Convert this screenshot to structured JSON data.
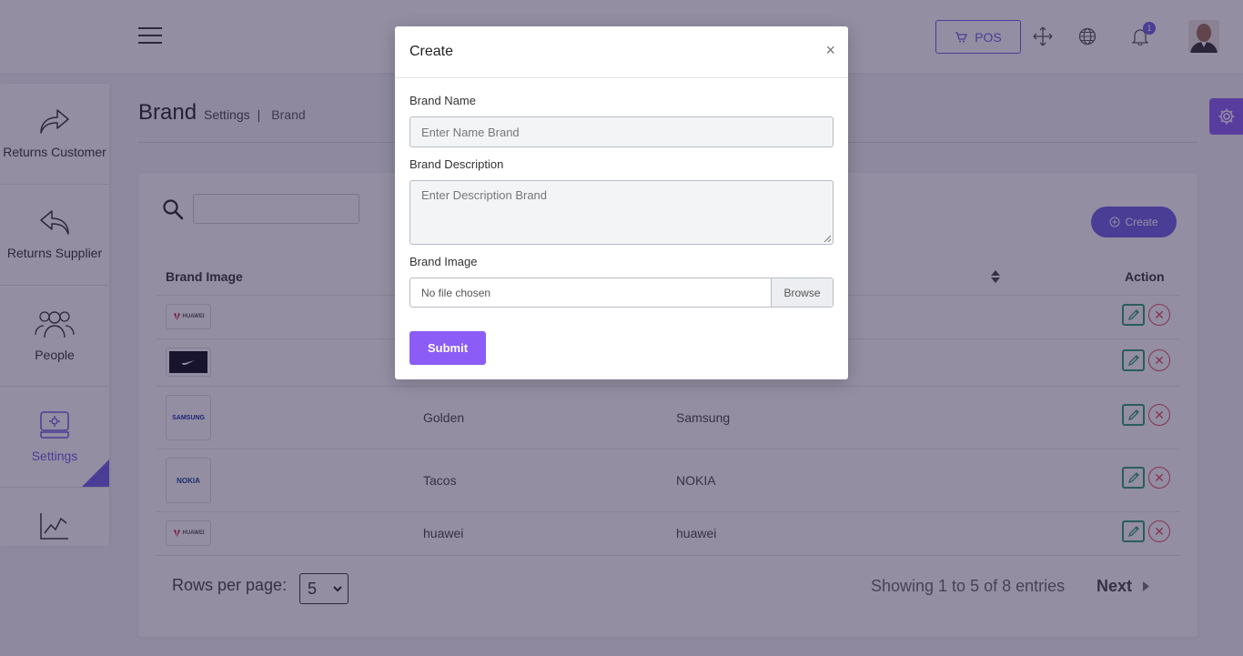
{
  "header": {
    "pos_label": "POS",
    "notification_count": "1"
  },
  "sidebar": {
    "items": [
      {
        "label": "Returns Customer",
        "icon": "share-forward-icon"
      },
      {
        "label": "Returns Supplier",
        "icon": "reply-icon"
      },
      {
        "label": "People",
        "icon": "people-icon"
      },
      {
        "label": "Settings",
        "icon": "settings-box-icon",
        "active": true
      },
      {
        "label": "",
        "icon": "chart-line-icon"
      }
    ]
  },
  "page": {
    "title": "Brand",
    "breadcrumb_parent": "Settings",
    "breadcrumb_separator": "|",
    "breadcrumb_current": "Brand"
  },
  "table": {
    "create_label": "Create",
    "search_value": "",
    "columns": [
      "Brand Image",
      "Action"
    ],
    "rows": [
      {
        "logo": "HUAWEI",
        "name": "",
        "description": ""
      },
      {
        "logo": "NIKE",
        "name": "",
        "description": ""
      },
      {
        "logo": "SAMSUNG",
        "name": "Golden",
        "description": "Samsung"
      },
      {
        "logo": "NOKIA",
        "name": "Tacos",
        "description": "NOKIA"
      },
      {
        "logo": "HUAWEI",
        "name": "huawei",
        "description": "huawei"
      }
    ],
    "rows_per_page_label": "Rows per page:",
    "rows_per_page_value": "5",
    "showing_text": "Showing 1 to 5 of 8 entries",
    "next_label": "Next"
  },
  "modal": {
    "title": "Create",
    "close_symbol": "×",
    "brand_name_label": "Brand Name",
    "brand_name_placeholder": "Enter Name Brand",
    "brand_description_label": "Brand Description",
    "brand_description_placeholder": "Enter Description Brand",
    "brand_image_label": "Brand Image",
    "file_status": "No file chosen",
    "browse_label": "Browse",
    "submit_label": "Submit"
  },
  "colors": {
    "accent": "#6c5ce7",
    "submit": "#8b5cf6",
    "edit": "#2e9d73",
    "delete": "#e5485e"
  }
}
